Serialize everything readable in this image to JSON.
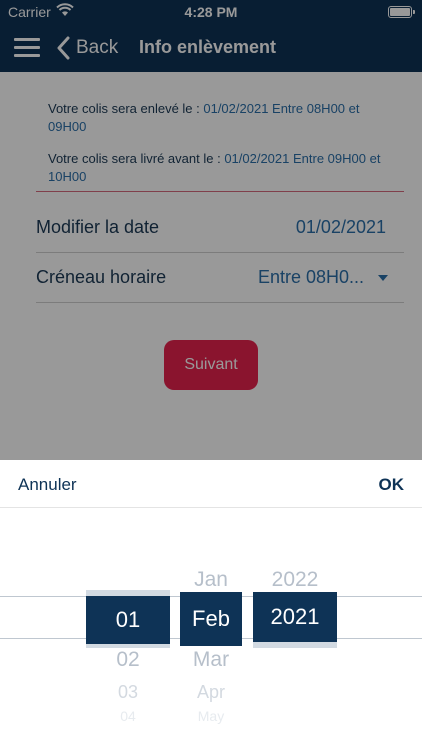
{
  "status_bar": {
    "carrier": "Carrier",
    "time": "4:28 PM",
    "icons": [
      "wifi-icon",
      "battery-icon"
    ]
  },
  "nav": {
    "menu_icon": "hamburger-menu-icon",
    "back_label": "Back",
    "title": "Info enlèvement"
  },
  "info": {
    "pickup_text": "Votre colis sera enlevé le : ",
    "pickup_value": "01/02/2021 Entre 08H00 et 09H00",
    "delivery_text": "Votre colis sera livré avant le : ",
    "delivery_value": "01/02/2021 Entre 09H00 et 10H00"
  },
  "form": {
    "date_label": "Modifier la date",
    "date_value": "01/02/2021",
    "slot_label": "Créneau horaire",
    "slot_value": "Entre 08H0..."
  },
  "next_label": "Suivant",
  "picker": {
    "cancel_label": "Annuler",
    "ok_label": "OK",
    "day": {
      "selected": "01",
      "below": [
        "02",
        "03",
        "04"
      ]
    },
    "month": {
      "above": "Jan",
      "selected": "Feb",
      "below": [
        "Mar",
        "Apr",
        "May"
      ]
    },
    "year": {
      "above": "2022",
      "selected": "2021"
    }
  },
  "colors": {
    "brand_navy": "#0e3356",
    "accent_pink": "#e6224e",
    "link_blue": "#2b6ea8"
  }
}
